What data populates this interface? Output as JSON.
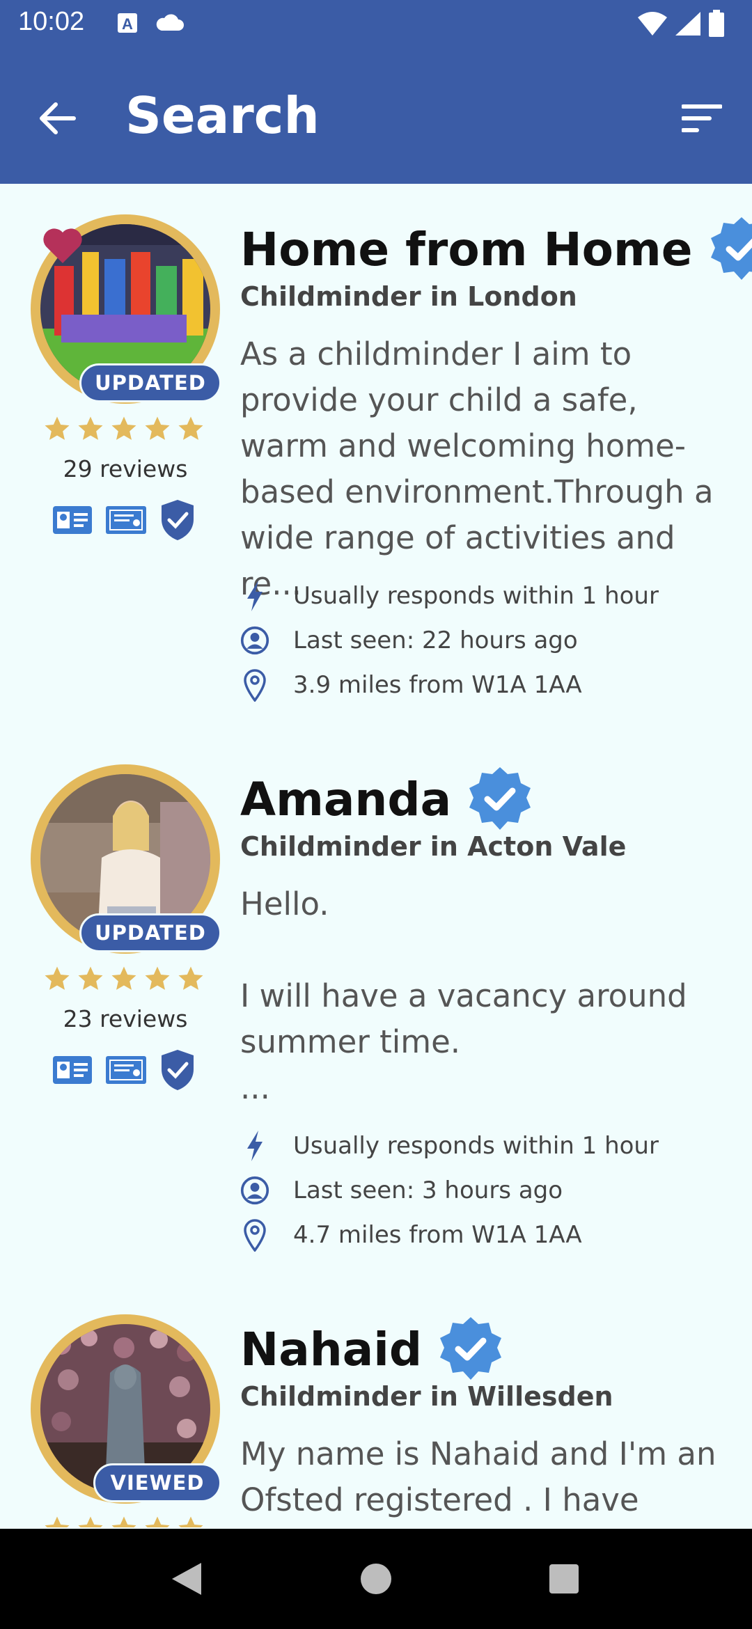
{
  "status_bar": {
    "time": "10:02",
    "icons_left": [
      "a-box-icon",
      "cloud-icon"
    ],
    "icons_right": [
      "wifi-icon",
      "signal-icon",
      "battery-icon"
    ]
  },
  "app_bar": {
    "title": "Search",
    "back_icon": "arrow-left-icon",
    "filter_icon": "sort-filter-icon",
    "color": "#3b5ca6"
  },
  "listings": [
    {
      "name": "Home from Home",
      "subtitle": "Childminder in London",
      "description": "As a childminder I aim to provide your child a safe, warm and welcoming home-based environment.Through a wide range of activities and re...",
      "badge": "UPDATED",
      "favourite": true,
      "rating": 5,
      "reviews": "29 reviews",
      "response": "Usually responds within 1 hour",
      "last_seen": "Last seen: 22 hours ago",
      "distance": "3.9 miles from W1A 1AA"
    },
    {
      "name": "Amanda",
      "subtitle": "Childminder in Acton Vale",
      "description": "Hello.\n\nI will have a vacancy around summer time.\n ...",
      "badge": "UPDATED",
      "favourite": false,
      "rating": 5,
      "reviews": "23 reviews",
      "response": "Usually responds within 1 hour",
      "last_seen": "Last seen: 3 hours ago",
      "distance": "4.7 miles from W1A 1AA"
    },
    {
      "name": "Nahaid",
      "subtitle": "Childminder in Willesden",
      "description": "My name is Nahaid and I'm an Ofsted registered . I have",
      "badge": "VIEWED",
      "favourite": false,
      "rating": 5
    }
  ],
  "colors": {
    "accent": "#3b5ca6",
    "ring": "#e3b95c",
    "star": "#e3b95c",
    "verified": "#4a8fdc",
    "heart": "#b5315a",
    "background": "#f1fdfd"
  }
}
